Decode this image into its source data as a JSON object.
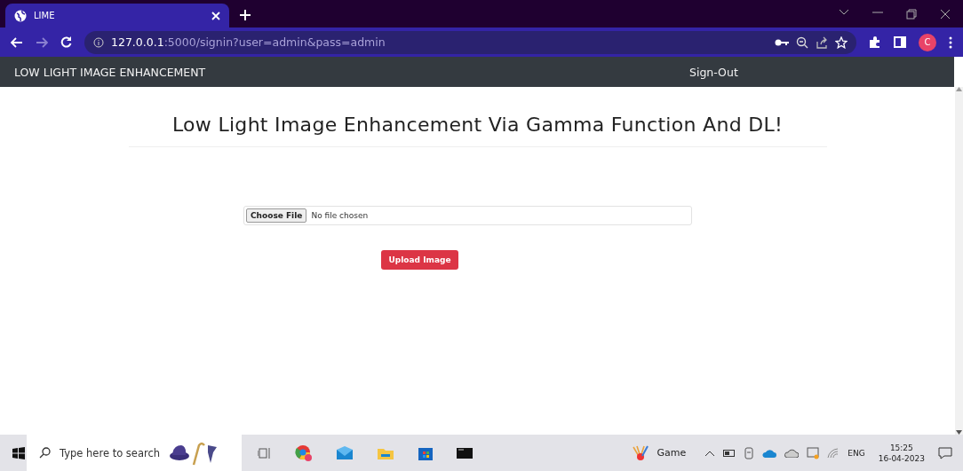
{
  "browser": {
    "tab": {
      "title": "LIME",
      "selected": true
    },
    "address": {
      "host": "127.0.0.1",
      "rest": ":5000/signin?user=admin&pass=admin"
    },
    "profile": "C"
  },
  "navbar": {
    "brand": "LOW LIGHT IMAGE ENHANCEMENT",
    "link": "Sign-Out"
  },
  "page": {
    "heading": "Low Light Image Enhancement Via Gamma Function And DL!",
    "file_button": "Choose File",
    "file_status": "No file chosen",
    "submit": "Upload Image"
  },
  "taskbar": {
    "search": {
      "placeholder": "Type here to search"
    },
    "weather": "Game",
    "language": "ENG",
    "time": "15:25",
    "date": "16-04-2023"
  }
}
